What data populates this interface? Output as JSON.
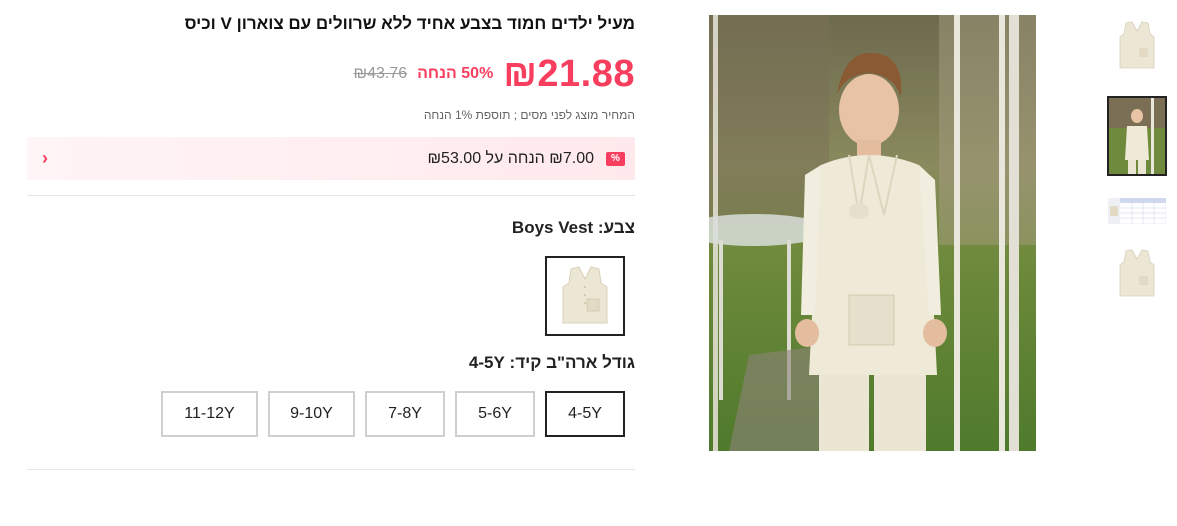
{
  "product": {
    "title": "מעיל ילדים חמוד בצבע אחיד ללא שרוולים עם צוארון V וכיס",
    "price": "₪21.88",
    "discount": "50% הנחה",
    "old_price": "₪43.76",
    "tax_note": "המחיר מוצג לפני מסים ; תוספת 1% הנחה"
  },
  "promo": {
    "badge": "%",
    "text": "₪7.00 הנחה על ₪53.00"
  },
  "color": {
    "label": "צבע:",
    "value": "Boys Vest"
  },
  "size": {
    "label": "גודל ארה\"ב קיד:",
    "value": "4-5Y",
    "options": [
      "4-5Y",
      "5-6Y",
      "7-8Y",
      "9-10Y",
      "11-12Y"
    ],
    "selected_index": 0
  },
  "colors": {
    "accent": "#f73e5e",
    "promo_bg": "#ffe9ec",
    "vest": "#ece6d4"
  },
  "icons": {
    "promo_chevron": "chevron-left-icon",
    "promo_badge": "percent-badge-icon"
  },
  "gallery": {
    "thumbnails": [
      "vest-front",
      "boy-wearing-vest",
      "size-chart",
      "vest-back"
    ],
    "selected_index": 1
  }
}
